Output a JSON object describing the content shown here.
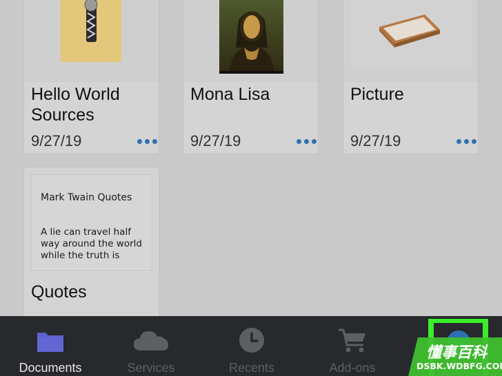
{
  "cards": [
    {
      "title_line1": "Hello World",
      "title_line2": "Sources",
      "date": "9/27/19"
    },
    {
      "title": "Mona Lisa",
      "date": "9/27/19"
    },
    {
      "title": "Picture",
      "date": "9/27/19"
    },
    {
      "title": "Quotes",
      "note_title": "Mark Twain Quotes",
      "note_body_line1": "A lie can travel half",
      "note_body_line2": "way around the world",
      "note_body_line3": "while the truth is"
    }
  ],
  "tabbar": {
    "tabs": [
      {
        "label": "Documents",
        "icon": "folder-icon",
        "active": true
      },
      {
        "label": "Services",
        "icon": "cloud-icon"
      },
      {
        "label": "Recents",
        "icon": "clock-icon"
      },
      {
        "label": "Add-ons",
        "icon": "cart-icon"
      }
    ]
  },
  "watermark": {
    "line1": "懂事百科",
    "line2": "DSBK.WDBFG.COM"
  },
  "colors": {
    "highlight": "#3aee2a",
    "accent": "#2f6fb3",
    "tabbar": "#27292c"
  }
}
